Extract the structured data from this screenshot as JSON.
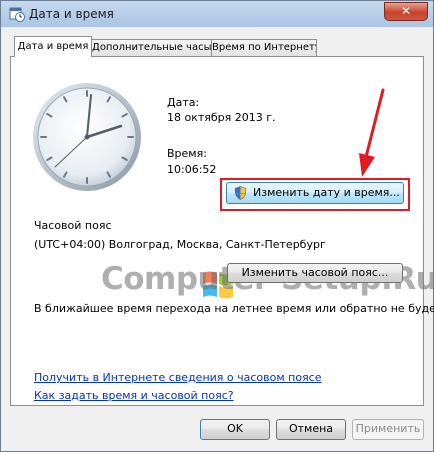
{
  "window": {
    "title": "Дата и время",
    "close_glyph": "✕"
  },
  "tabs": [
    {
      "label": "Дата и время",
      "active": true
    },
    {
      "label": "Дополнительные часы",
      "active": false
    },
    {
      "label": "Время по Интернету",
      "active": false
    }
  ],
  "datetime": {
    "date_label": "Дата:",
    "date_value": "18 октября 2013 г.",
    "time_label": "Время:",
    "time_value": "10:06:52",
    "change_button": "Изменить дату и время..."
  },
  "timezone": {
    "section_label": "Часовой пояс",
    "value": "(UTC+04:00) Волгоград, Москва, Санкт-Петербург",
    "change_button": "Изменить часовой пояс...",
    "dst_note": "В ближайшее время перехода на летнее время или обратно не будет."
  },
  "links": [
    "Получить в Интернете сведения о часовом поясе",
    "Как задать время и часовой пояс?"
  ],
  "buttons": {
    "ok": "OK",
    "cancel": "Отмена",
    "apply": "Применить"
  },
  "watermark": "Computer-Setup.Ru",
  "colors": {
    "highlight": "#e11b22",
    "link": "#0033cc",
    "arrow": "#e11b22"
  },
  "icons": [
    "calendar-clock-icon",
    "shield-icon",
    "windows-flag-icon"
  ]
}
